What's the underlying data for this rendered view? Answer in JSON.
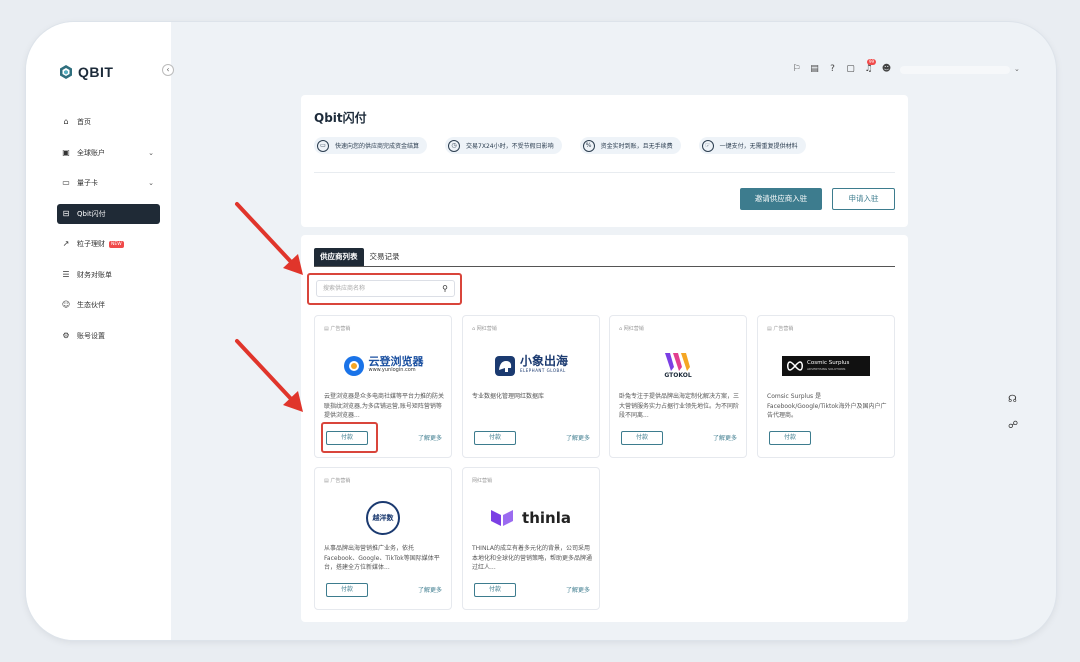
{
  "app": {
    "name": "QBIT"
  },
  "sidebar": {
    "collapse_icon": "chevron-left-icon",
    "items": [
      {
        "label": "首页",
        "icon": "home-icon",
        "expandable": false,
        "active": false
      },
      {
        "label": "全球账户",
        "icon": "account-icon",
        "expandable": true,
        "active": false
      },
      {
        "label": "量子卡",
        "icon": "card-icon",
        "expandable": true,
        "active": false
      },
      {
        "label": "Qbit闪付",
        "icon": "flash-pay-icon",
        "expandable": false,
        "active": true
      },
      {
        "label": "粒子理财",
        "icon": "chart-icon",
        "expandable": false,
        "active": false,
        "badge": "NEW"
      },
      {
        "label": "财务对账单",
        "icon": "statement-icon",
        "expandable": false,
        "active": false
      },
      {
        "label": "生态伙伴",
        "icon": "partners-icon",
        "expandable": false,
        "active": false
      },
      {
        "label": "账号设置",
        "icon": "settings-icon",
        "expandable": false,
        "active": false
      }
    ]
  },
  "topbar": {
    "icons": [
      "translate-icon",
      "wallet-icon",
      "help-icon",
      "document-icon",
      "bell-icon",
      "user-icon"
    ],
    "bell_badge": "99"
  },
  "header_card": {
    "title": "Qbit闪付",
    "features": [
      "快速向您的供应商完成资金结算",
      "交易7X24小时，不受节假日影响",
      "资金实时到账，且无手续费",
      "一键支付，无需重复提供材料"
    ],
    "invite_button": "邀请供应商入驻",
    "apply_button": "申请入驻"
  },
  "main": {
    "tabs": [
      {
        "label": "供应商列表",
        "active": true
      },
      {
        "label": "交易记录",
        "active": false
      }
    ],
    "search": {
      "placeholder": "搜索供应商名称",
      "icon": "search-icon"
    },
    "pay_label": "付款",
    "more_label": "了解更多",
    "suppliers": [
      {
        "category": "广告营销",
        "logo_text": "云登浏览器",
        "logo_sub": "www.yunlogin.com",
        "desc": "云登浏览器是众多电商社媒等平台力推的防关联指纹浏览器,为多店铺运营,账号矩阵营销等提供浏览器...",
        "has_more": true
      },
      {
        "category": "网红营销",
        "logo_text": "小象出海",
        "logo_sub": "ELEPHANT GLOBAL",
        "desc": "专业数据化管理网红数据库",
        "has_more": true
      },
      {
        "category": "网红营销",
        "logo_text": "GTOKOL",
        "logo_sub": "",
        "desc": "卧兔专注于提供品牌出海定制化解决方案，三大营销服务实力占据行业领先地位。为不同阶段不同离...",
        "has_more": true
      },
      {
        "category": "广告营销",
        "logo_text": "Cosmic Surplus",
        "logo_sub": "ADVERTISING SOLUTIONS",
        "desc": "Comsic Surplus 是Facebook/Google/Tiktok海外户及国内户广告代理商。",
        "has_more": false
      },
      {
        "category": "广告营销",
        "logo_text": "越洋数",
        "logo_sub": "",
        "desc": "从事品牌出海营销推广业务，依托Facebook、Google、TikTok等国际媒体平台，搭建全方位新媒体...",
        "has_more": true
      },
      {
        "category": "网红营销",
        "logo_text": "thinla",
        "logo_sub": "",
        "desc": "THINLA的成立有着多元化的背景，公司采用本地化和全球化的营销策略，帮助更多品牌通过红人...",
        "has_more": true
      }
    ]
  },
  "colors": {
    "accent": "#3d7c8e",
    "nav_active": "#1f2a36",
    "highlight": "#d9453b"
  }
}
